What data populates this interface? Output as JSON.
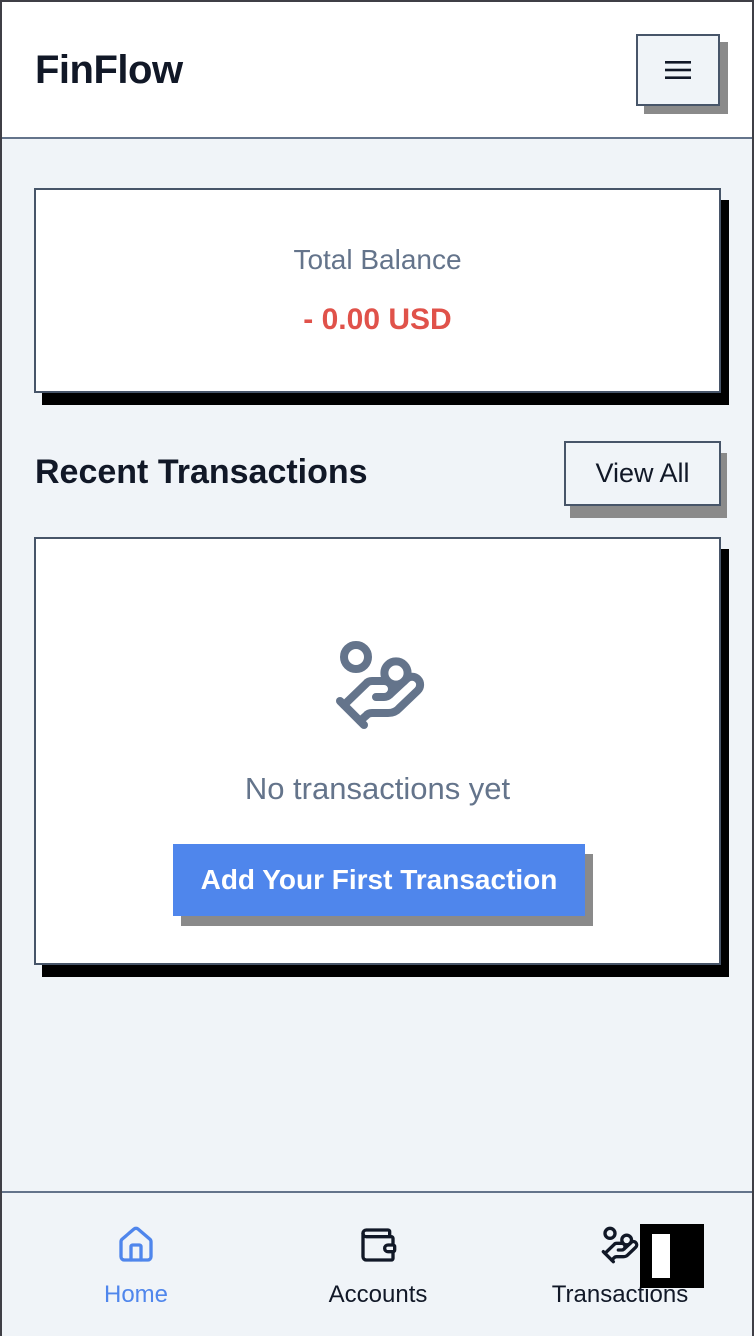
{
  "app": {
    "name": "FinFlow"
  },
  "header": {
    "menu_icon": "hamburger-menu-icon"
  },
  "balance": {
    "label": "Total Balance",
    "value": "- 0.00 USD",
    "value_color": "#e0524a"
  },
  "recent": {
    "title": "Recent Transactions",
    "view_all_label": "View All",
    "empty_icon": "hand-coins-icon",
    "empty_text": "No transactions yet",
    "add_button_label": "Add Your First Transaction"
  },
  "bottom_nav": {
    "items": [
      {
        "label": "Home",
        "icon": "home-icon",
        "active": true
      },
      {
        "label": "Accounts",
        "icon": "wallet-icon",
        "active": false
      },
      {
        "label": "Transactions",
        "icon": "hand-coins-icon",
        "active": false
      }
    ]
  },
  "colors": {
    "accent": "#4f86ec",
    "background": "#f0f4f8",
    "negative": "#e0524a",
    "muted_text": "#64748b"
  }
}
